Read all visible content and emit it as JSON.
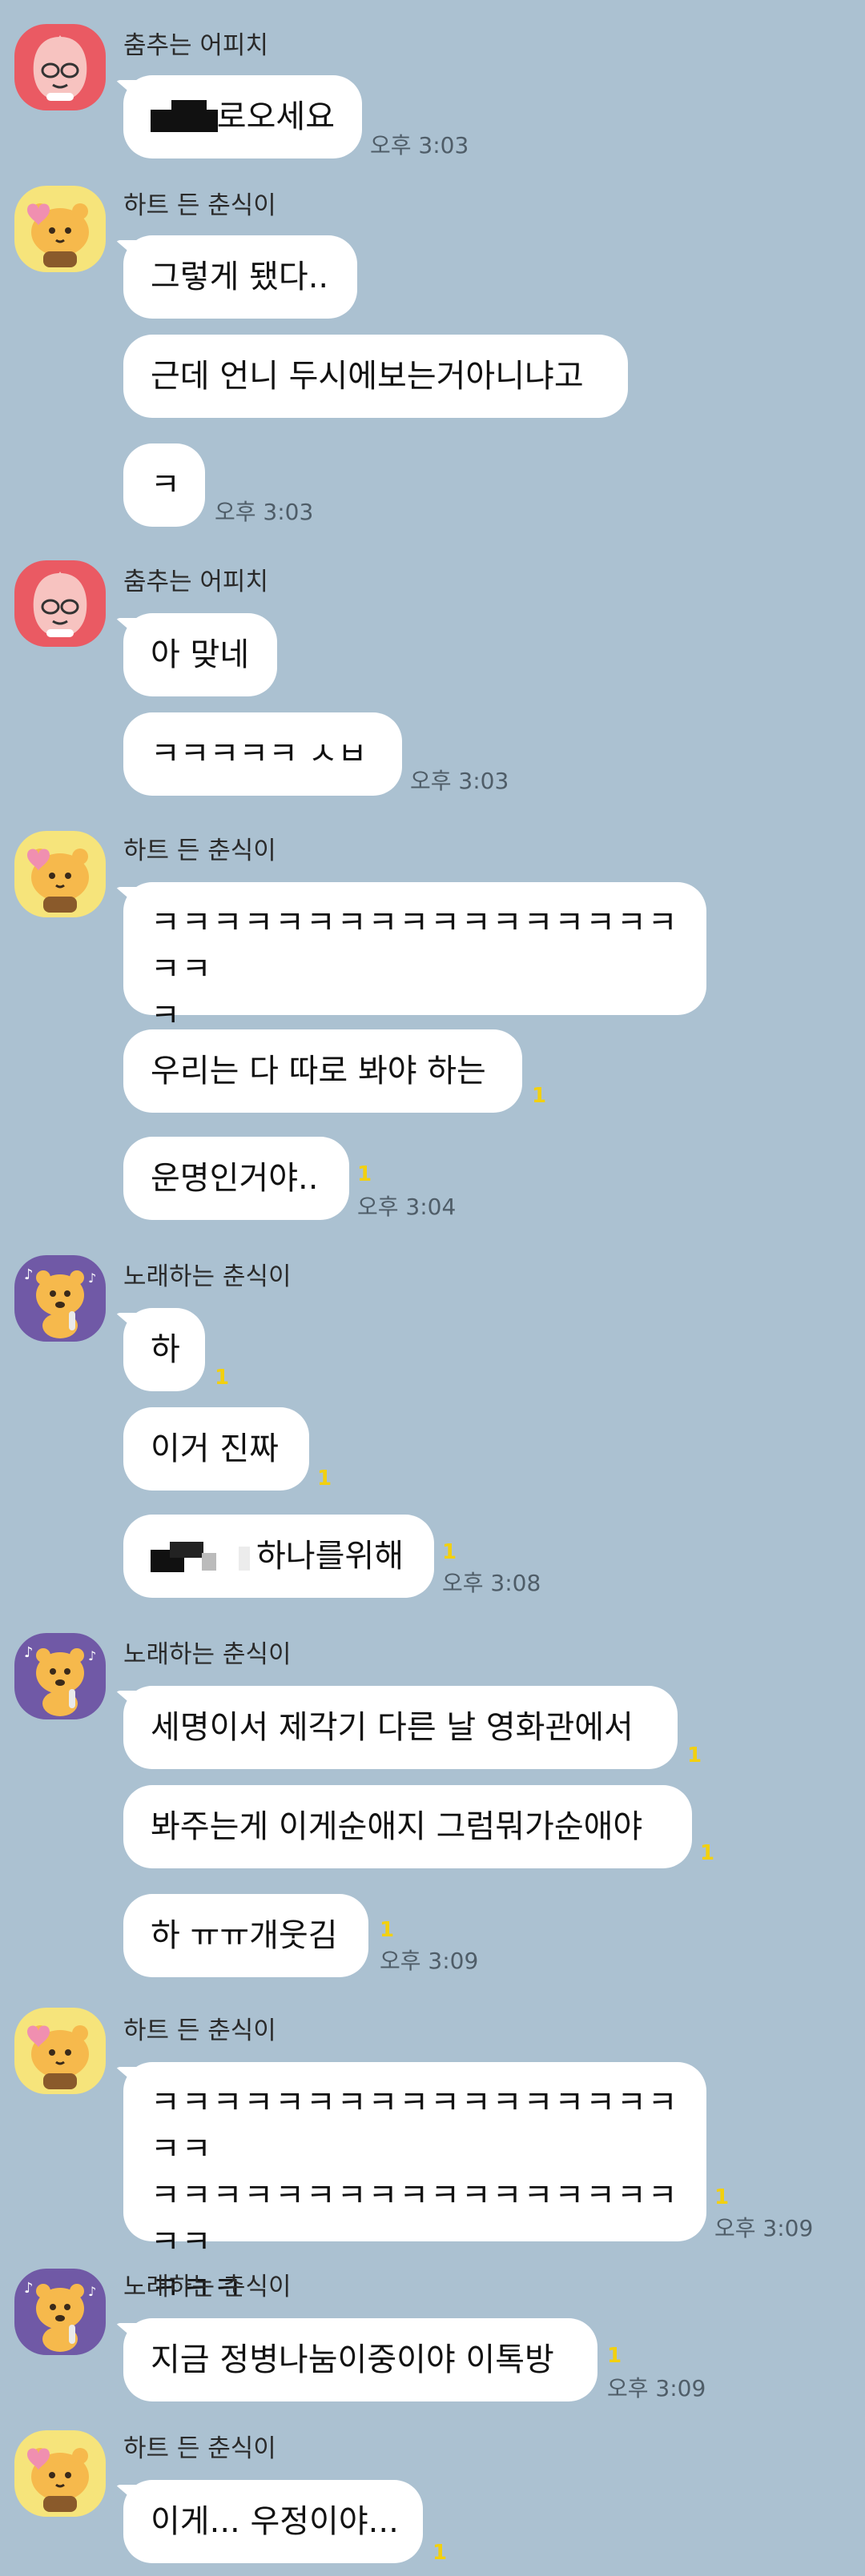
{
  "colors": {
    "background": "#abc1d1",
    "bubble": "#ffffff",
    "unread": "#f2d00f",
    "time": "#4f5d68"
  },
  "icons": {
    "apeach": "apeach-avatar-icon",
    "choonsik_heart": "choonsik-heart-avatar-icon",
    "choonsik_singing": "choonsik-singing-avatar-icon"
  },
  "messages": [
    {
      "sender": "춤추는 어피치",
      "bubbles": [
        {
          "text": "로오세요",
          "unread": "",
          "time": "오후 3:03"
        }
      ]
    },
    {
      "sender": "하트 든 춘식이",
      "bubbles": [
        {
          "text": "그렇게 됐다..",
          "unread": "",
          "time": ""
        },
        {
          "text": "근데 언니 두시에보는거아니냐고",
          "unread": "",
          "time": ""
        },
        {
          "text": "ㅋ",
          "unread": "",
          "time": "오후 3:03"
        }
      ]
    },
    {
      "sender": "춤추는 어피치",
      "bubbles": [
        {
          "text": "아 맞네",
          "unread": "",
          "time": ""
        },
        {
          "text": "ㅋㅋㅋㅋㅋ ㅅㅂ",
          "unread": "",
          "time": "오후 3:03"
        }
      ]
    },
    {
      "sender": "하트 든 춘식이",
      "bubbles": [
        {
          "lines": [
            "ㅋㅋㅋㅋㅋㅋㅋㅋㅋㅋㅋㅋㅋㅋㅋㅋㅋㅋㅋ",
            "ㅋ"
          ],
          "unread": "",
          "time": ""
        },
        {
          "text": "우리는 다 따로 봐야 하는",
          "unread": "1",
          "time": ""
        },
        {
          "text": "운명인거야..",
          "unread": "1",
          "time": "오후 3:04"
        }
      ]
    },
    {
      "sender": "노래하는 춘식이",
      "bubbles": [
        {
          "text": "하",
          "unread": "1",
          "time": ""
        },
        {
          "text": "이거 진짜",
          "unread": "1",
          "time": ""
        },
        {
          "text": "하나를위해",
          "unread": "1",
          "time": "오후 3:08"
        }
      ]
    },
    {
      "sender": "노래하는 춘식이",
      "bubbles": [
        {
          "text": "세명이서 제각기 다른 날 영화관에서",
          "unread": "1",
          "time": ""
        },
        {
          "text": "봐주는게 이게순애지 그럼뭐가순애야",
          "unread": "1",
          "time": ""
        },
        {
          "text": "하 ㅠㅠ개웃김",
          "unread": "1",
          "time": "오후 3:09"
        }
      ]
    },
    {
      "sender": "하트 든 춘식이",
      "bubbles": [
        {
          "lines": [
            "ㅋㅋㅋㅋㅋㅋㅋㅋㅋㅋㅋㅋㅋㅋㅋㅋㅋㅋㅋ",
            "ㅋㅋㅋㅋㅋㅋㅋㅋㅋㅋㅋㅋㅋㅋㅋㅋㅋㅋㅋ",
            "ㅋㅋㅋ"
          ],
          "unread": "1",
          "time": "오후 3:09"
        }
      ]
    },
    {
      "sender": "노래하는 춘식이",
      "bubbles": [
        {
          "text": "지금 정병나눔이중이야 이톡방",
          "unread": "1",
          "time": "오후 3:09"
        }
      ]
    },
    {
      "sender": "하트 든 춘식이",
      "bubbles": [
        {
          "text": "이게... 우정이야...",
          "unread": "1",
          "time": ""
        }
      ]
    }
  ]
}
